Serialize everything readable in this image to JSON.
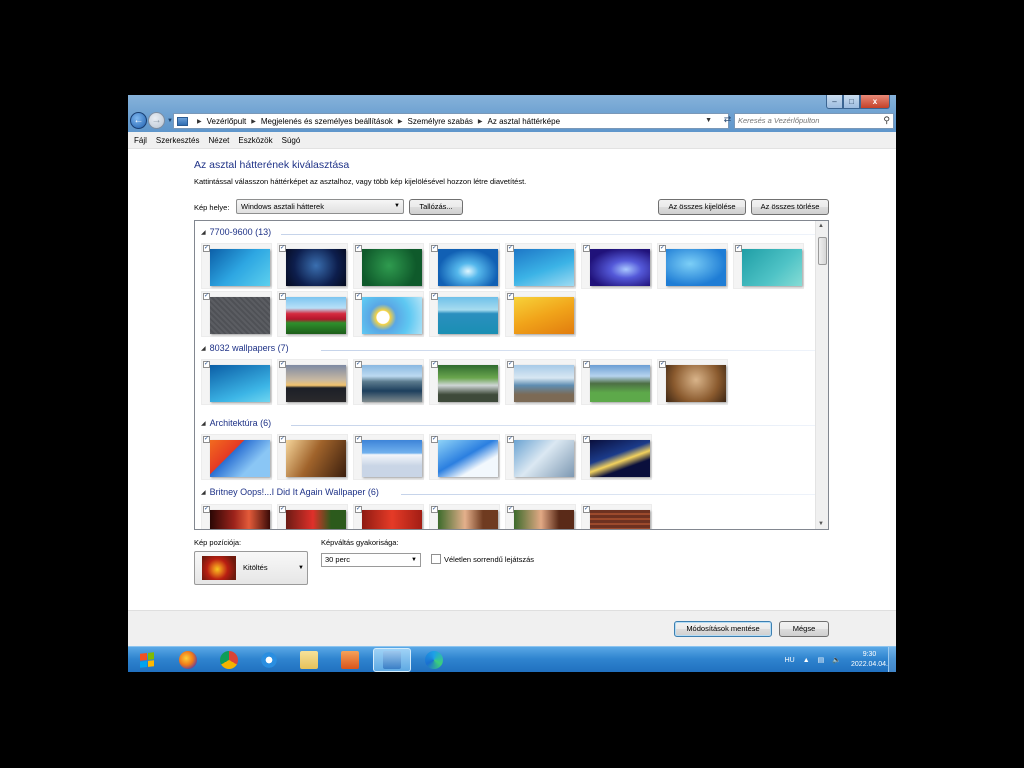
{
  "window": {
    "controls": {
      "minimize": "–",
      "maximize": "□",
      "close": "x"
    }
  },
  "nav": {
    "breadcrumbs": [
      "Vezérlőpult",
      "Megjelenés és személyes beállítások",
      "Személyre szabás",
      "Az asztal háttérképe"
    ],
    "search_placeholder": "Keresés a Vezérlőpulton"
  },
  "menu": [
    "Fájl",
    "Szerkesztés",
    "Nézet",
    "Eszközök",
    "Súgó"
  ],
  "content": {
    "title": "Az asztal hátterének kiválasztása",
    "description": "Kattintással válasszon háttérképet az asztalhoz, vagy több kép kijelölésével hozzon létre diavetítést.",
    "location_label": "Kép helye:",
    "location_value": "Windows asztali hátterek",
    "browse_label": "Tallózás...",
    "select_all_label": "Az összes kijelölése",
    "clear_all_label": "Az összes törlése"
  },
  "groups": [
    {
      "title": "7700-9600 (13)",
      "thumbs": [
        "w-blue1",
        "w-navy",
        "w-green",
        "w-glow",
        "w-aqua",
        "w-purple",
        "w-lightblue",
        "w-teal",
        "w-grey",
        "w-tulips",
        "w-daisy",
        "w-lake",
        "w-orange"
      ]
    },
    {
      "title": "8032 wallpapers (7)",
      "thumbs": [
        "w-fish",
        "w-sunset",
        "w-crater",
        "w-river",
        "w-coast",
        "w-meadow",
        "w-cave"
      ]
    },
    {
      "title": "Architektúra (6)",
      "thumbs": [
        "w-arch1",
        "w-arch2",
        "w-arch3",
        "w-arch4",
        "w-arch5",
        "w-arch6"
      ]
    },
    {
      "title": "Britney Oops!...I Did It Again Wallpaper (6)",
      "thumbs": [
        "w-bs1",
        "w-bs2",
        "w-bs3",
        "w-bs4",
        "w-bs5",
        "w-bs6"
      ]
    }
  ],
  "options": {
    "position_label": "Kép pozíciója:",
    "position_value": "Kitöltés",
    "frequency_label": "Képváltás gyakorisága:",
    "frequency_value": "30 perc",
    "shuffle_label": "Véletlen sorrendű lejátszás"
  },
  "footer": {
    "save_label": "Módosítások mentése",
    "cancel_label": "Mégse"
  },
  "taskbar": {
    "apps": [
      "firefox-icon",
      "chrome-icon",
      "internet-explorer-icon",
      "file-explorer-icon",
      "media-player-icon",
      "control-panel-icon",
      "edge-icon"
    ],
    "language": "HU",
    "time": "9:30",
    "date": "2022.04.04."
  }
}
